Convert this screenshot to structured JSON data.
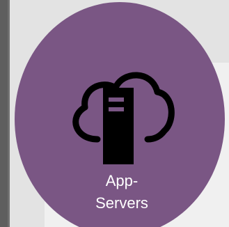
{
  "node": {
    "label_line1": "App-",
    "label_line2": "Servers",
    "icon": "cloud-server-icon"
  },
  "colors": {
    "circle": "#7a5684",
    "background": "#666666",
    "panel": "#e3e3e3",
    "icon": "#000000",
    "label": "#ffffff"
  }
}
